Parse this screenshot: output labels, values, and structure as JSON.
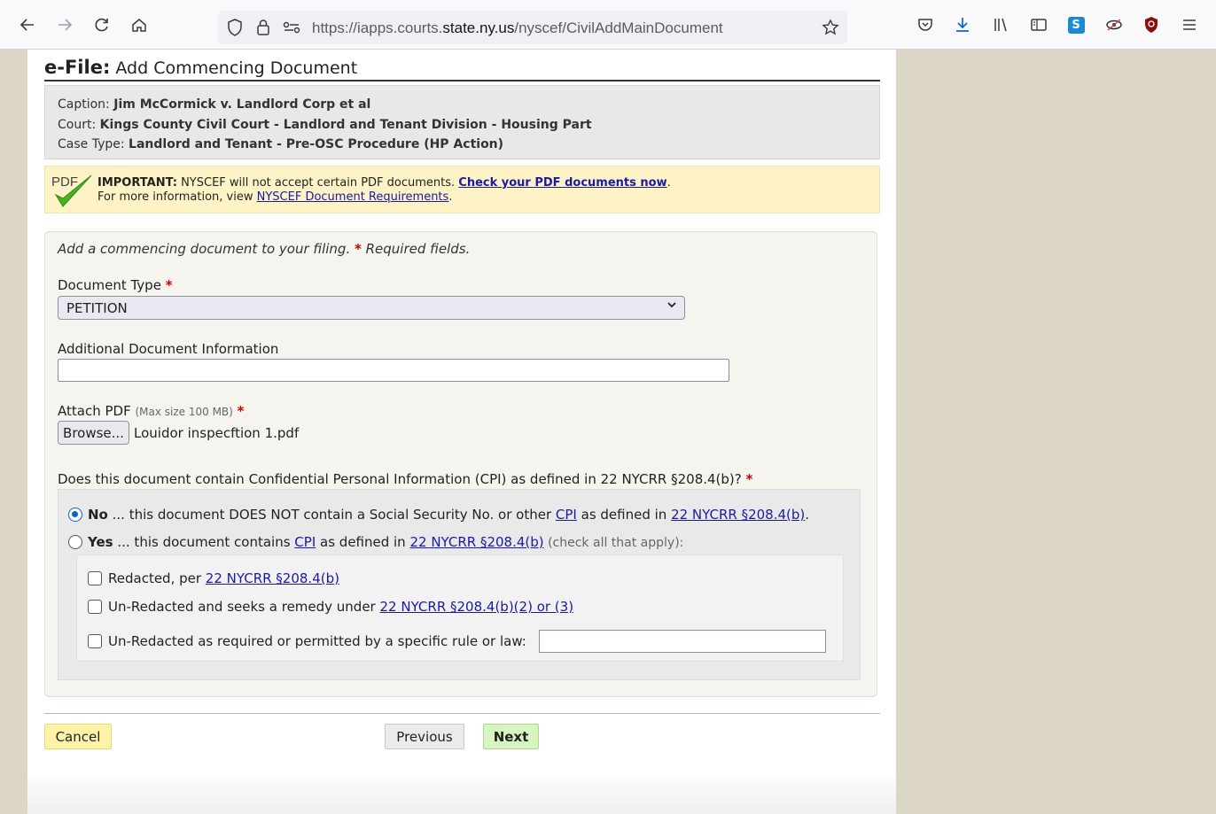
{
  "browser": {
    "url_prefix": "https://iapps.courts.",
    "url_domain": "state.ny.us",
    "url_path": "/nyscef/CivilAddMainDocument",
    "extension_label": "S"
  },
  "page": {
    "title_bold": "e-File:",
    "title_rest": " Add Commencing Document",
    "caption_label": "Caption: ",
    "caption_value": "Jim McCormick v. Landlord Corp et al",
    "court_label": "Court: ",
    "court_value": "Kings County Civil Court - Landlord and Tenant Division - Housing Part",
    "case_type_label": "Case Type: ",
    "case_type_value": "Landlord and Tenant - Pre-OSC Procedure (HP Action)",
    "pdf_logo_text": "PDF",
    "important_label": "IMPORTANT:",
    "important_text": " NYSCEF will not accept certain PDF documents. ",
    "check_link": "Check your PDF documents now",
    "period": ".",
    "more_info_text": "For more information, view ",
    "requirements_link": "NYSCEF Document Requirements",
    "intro_text": "Add a commencing document to your filing. ",
    "required_star": "*",
    "required_text": " Required fields.",
    "doc_type_label": "Document Type ",
    "doc_type_value": "PETITION",
    "additional_info_label": "Additional Document Information",
    "attach_label": "Attach PDF ",
    "attach_hint": "(Max size 100 MB)",
    "browse_label": "Browse...",
    "file_name": "Louidor inspecftion 1.pdf",
    "cpi_question": "Does this document contain Confidential Personal Information (CPI) as defined in 22 NYCRR §208.4(b)? ",
    "no_label": "No",
    "no_text": " ... this document DOES NOT contain a Social Security No. or other ",
    "cpi_link": "CPI",
    "as_defined_in": " as defined in ",
    "nycrr_link": "22 NYCRR §208.4(b)",
    "yes_label": "Yes",
    "yes_text": " ... this document contains ",
    "check_all_text": " (check all that apply):",
    "redacted_text": "Redacted, per ",
    "unredacted_remedy_text": "Un-Redacted and seeks a remedy under ",
    "remedy_link": "22 NYCRR §208.4(b)(2) or (3)",
    "unredacted_rule_text": "Un-Redacted as required or permitted by a specific rule or law: ",
    "cancel_label": "Cancel",
    "previous_label": "Previous",
    "next_label": "Next"
  }
}
